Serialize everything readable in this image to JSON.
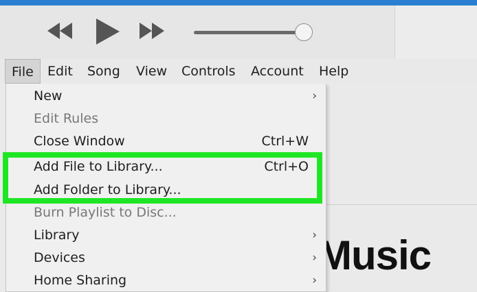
{
  "toolbar": {
    "rewind_icon": "rewind-icon",
    "play_icon": "play-icon",
    "fast_forward_icon": "fast-forward-icon",
    "volume_level": 0.92
  },
  "menubar": {
    "items": [
      "File",
      "Edit",
      "Song",
      "View",
      "Controls",
      "Account",
      "Help"
    ],
    "active": "File"
  },
  "file_menu": {
    "items": [
      {
        "label": "New",
        "shortcut": "",
        "submenu": true,
        "enabled": true
      },
      {
        "label": "Edit Rules",
        "shortcut": "",
        "submenu": false,
        "enabled": false
      },
      {
        "label": "Close Window",
        "shortcut": "Ctrl+W",
        "submenu": false,
        "enabled": true
      },
      {
        "label": "Add File to Library...",
        "shortcut": "Ctrl+O",
        "submenu": false,
        "enabled": true
      },
      {
        "label": "Add Folder to Library...",
        "shortcut": "",
        "submenu": false,
        "enabled": true
      },
      {
        "label": "Burn Playlist to Disc...",
        "shortcut": "",
        "submenu": false,
        "enabled": false
      },
      {
        "label": "Library",
        "shortcut": "",
        "submenu": true,
        "enabled": true
      },
      {
        "label": "Devices",
        "shortcut": "",
        "submenu": true,
        "enabled": true
      },
      {
        "label": "Home Sharing",
        "shortcut": "",
        "submenu": true,
        "enabled": true
      }
    ],
    "submenu_arrow": "›"
  },
  "content": {
    "title": "Music"
  },
  "highlight_color": "#1fe624"
}
